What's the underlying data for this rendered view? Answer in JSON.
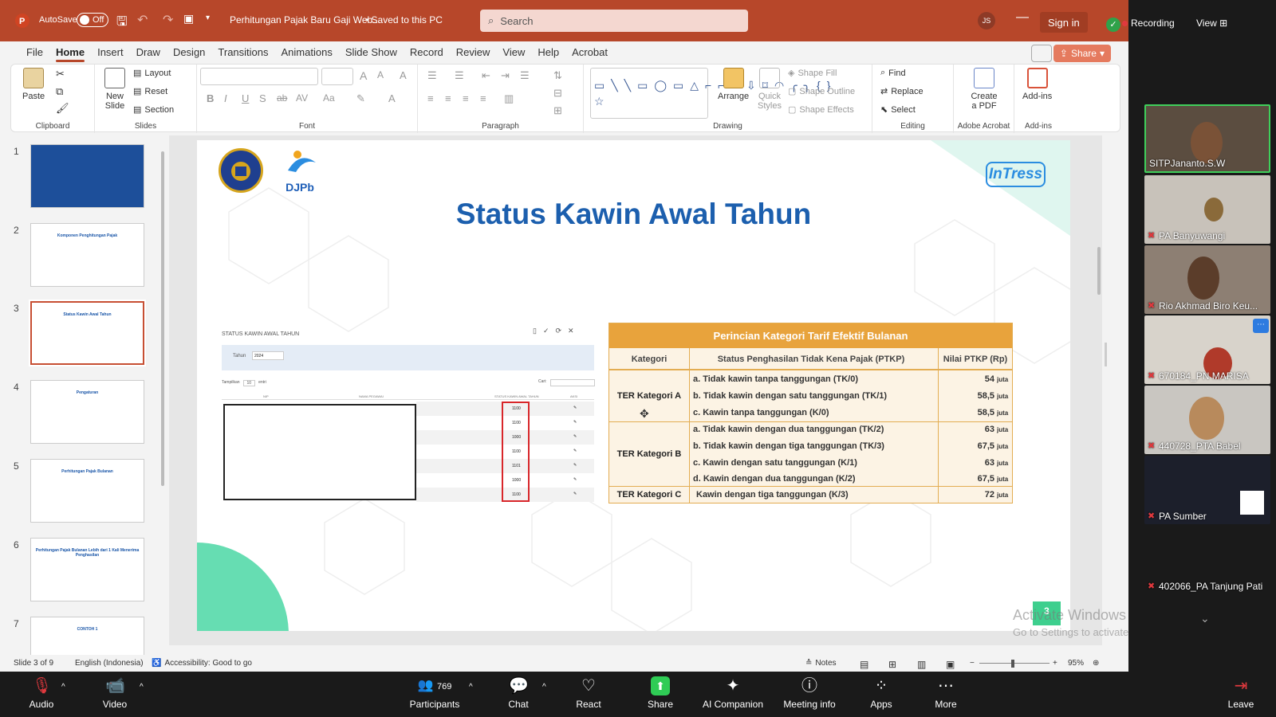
{
  "titlebar": {
    "autosave_label": "AutoSave",
    "autosave_state": "Off",
    "doc_title": "Perhitungan Pajak Baru Gaji Web...",
    "save_status": "• Saved to this PC",
    "search_placeholder": "Search",
    "user_initials": "JS",
    "signin_label": "Sign in",
    "recording_label": "Recording",
    "view_label": "View"
  },
  "menu": {
    "items": [
      "File",
      "Home",
      "Insert",
      "Draw",
      "Design",
      "Transitions",
      "Animations",
      "Slide Show",
      "Record",
      "Review",
      "View",
      "Help",
      "Acrobat"
    ],
    "active": "Home",
    "share_label": "Share"
  },
  "ribbon": {
    "clipboard": {
      "label": "Clipboard",
      "paste": "Paste"
    },
    "slides": {
      "label": "Slides",
      "new_slide": "New Slide",
      "layout": "Layout",
      "reset": "Reset",
      "section": "Section"
    },
    "font": {
      "label": "Font"
    },
    "paragraph": {
      "label": "Paragraph"
    },
    "drawing": {
      "label": "Drawing",
      "arrange": "Arrange",
      "quick_styles": "Quick Styles",
      "shape_fill": "Shape Fill",
      "shape_outline": "Shape Outline",
      "shape_effects": "Shape Effects"
    },
    "editing": {
      "label": "Editing",
      "find": "Find",
      "replace": "Replace",
      "select": "Select"
    },
    "adobe": {
      "label": "Adobe Acrobat",
      "create_pdf": "Create a PDF"
    },
    "addins": {
      "label": "Add-ins",
      "addins_btn": "Add-ins"
    }
  },
  "thumbnails": [
    {
      "num": "1",
      "title": ""
    },
    {
      "num": "2",
      "title": "Komponen Penghitungan Pajak"
    },
    {
      "num": "3",
      "title": "Status Kawin Awal Tahun"
    },
    {
      "num": "4",
      "title": "Pengaturan"
    },
    {
      "num": "5",
      "title": "Perhitungan Pajak Bulanan"
    },
    {
      "num": "6",
      "title": "Perhitungan Pajak Bulanan Lebih dari 1 Kali Menerima Penghasilan"
    },
    {
      "num": "7",
      "title": "CONTOH 1"
    }
  ],
  "slide": {
    "title": "Status Kawin Awal Tahun",
    "logo_djpb": "DJPb",
    "logo_intress": "InTress",
    "slide_number": "3",
    "screenshot": {
      "heading": "STATUS KAWIN AWAL TAHUN",
      "tahun_label": "Tahun",
      "tahun_value": "2024",
      "tampilkan": "Tampilkan",
      "tampilkan_value": "10",
      "entri": "entri",
      "cari": "Cari:",
      "col_nip": "NIP",
      "col_nama": "NAMA PEGAWAI",
      "col_status": "STATUS KAWIN AWAL TAHUN",
      "col_aksi": "AKSI",
      "status_values": [
        "1100",
        "1100",
        "1000",
        "1100",
        "1101",
        "1000",
        "1100"
      ]
    },
    "ptkp_table": {
      "heading": "Perincian Kategori Tarif Efektif Bulanan",
      "col_kategori": "Kategori",
      "col_status": "Status Penghasilan Tidak Kena Pajak (PTKP)",
      "col_nilai": "Nilai PTKP (Rp)",
      "groups": [
        {
          "kategori": "TER Kategori A",
          "rows": [
            {
              "status": "a. Tidak kawin tanpa tanggungan (TK/0)",
              "nilai": "54",
              "unit": "juta"
            },
            {
              "status": "b. Tidak kawin dengan satu tanggungan (TK/1)",
              "nilai": "58,5",
              "unit": "juta"
            },
            {
              "status": "c. Kawin tanpa tanggungan (K/0)",
              "nilai": "58,5",
              "unit": "juta"
            }
          ]
        },
        {
          "kategori": "TER Kategori B",
          "rows": [
            {
              "status": "a. Tidak kawin dengan dua tanggungan (TK/2)",
              "nilai": "63",
              "unit": "juta"
            },
            {
              "status": "b. Tidak kawin dengan tiga tanggungan (TK/3)",
              "nilai": "67,5",
              "unit": "juta"
            },
            {
              "status": "c. Kawin dengan satu tanggungan (K/1)",
              "nilai": "63",
              "unit": "juta"
            },
            {
              "status": "d. Kawin dengan dua tanggungan (K/2)",
              "nilai": "67,5",
              "unit": "juta"
            }
          ]
        },
        {
          "kategori": "TER Kategori C",
          "rows": [
            {
              "status": "Kawin dengan tiga tanggungan (K/3)",
              "nilai": "72",
              "unit": "juta"
            }
          ]
        }
      ]
    }
  },
  "watermark": {
    "line1": "Activate Windows",
    "line2": "Go to Settings to activate Windows."
  },
  "statusbar": {
    "slide_info": "Slide 3 of 9",
    "language": "English (Indonesia)",
    "accessibility": "Accessibility: Good to go",
    "notes": "Notes",
    "zoom": "95%"
  },
  "participants_tiles": [
    {
      "name": "SITPJananto.S.W",
      "muted": false,
      "active": true
    },
    {
      "name": "PA Banyuwangi",
      "muted": true,
      "active": false
    },
    {
      "name": "Rio Akhmad Biro Keu...",
      "muted": true,
      "active": false
    },
    {
      "name": "670184_PN MARISA",
      "muted": true,
      "active": false
    },
    {
      "name": "440728_PTA Babel",
      "muted": true,
      "active": false
    },
    {
      "name": "PA Sumber",
      "muted": true,
      "active": false
    },
    {
      "name": "402066_PA Tanjung Pati",
      "muted": true,
      "active": false
    }
  ],
  "zoom_toolbar": {
    "audio": "Audio",
    "video": "Video",
    "participants": "Participants",
    "participants_count": "769",
    "chat": "Chat",
    "react": "React",
    "share": "Share",
    "ai_companion": "AI Companion",
    "meeting_info": "Meeting info",
    "apps": "Apps",
    "more": "More",
    "leave": "Leave"
  },
  "colors": {
    "ppt_accent": "#b7472a",
    "slide_title": "#1c5fae",
    "table_header": "#e8a33c",
    "zoom_green": "#3fcf5b",
    "zoom_red": "#e0393e"
  }
}
